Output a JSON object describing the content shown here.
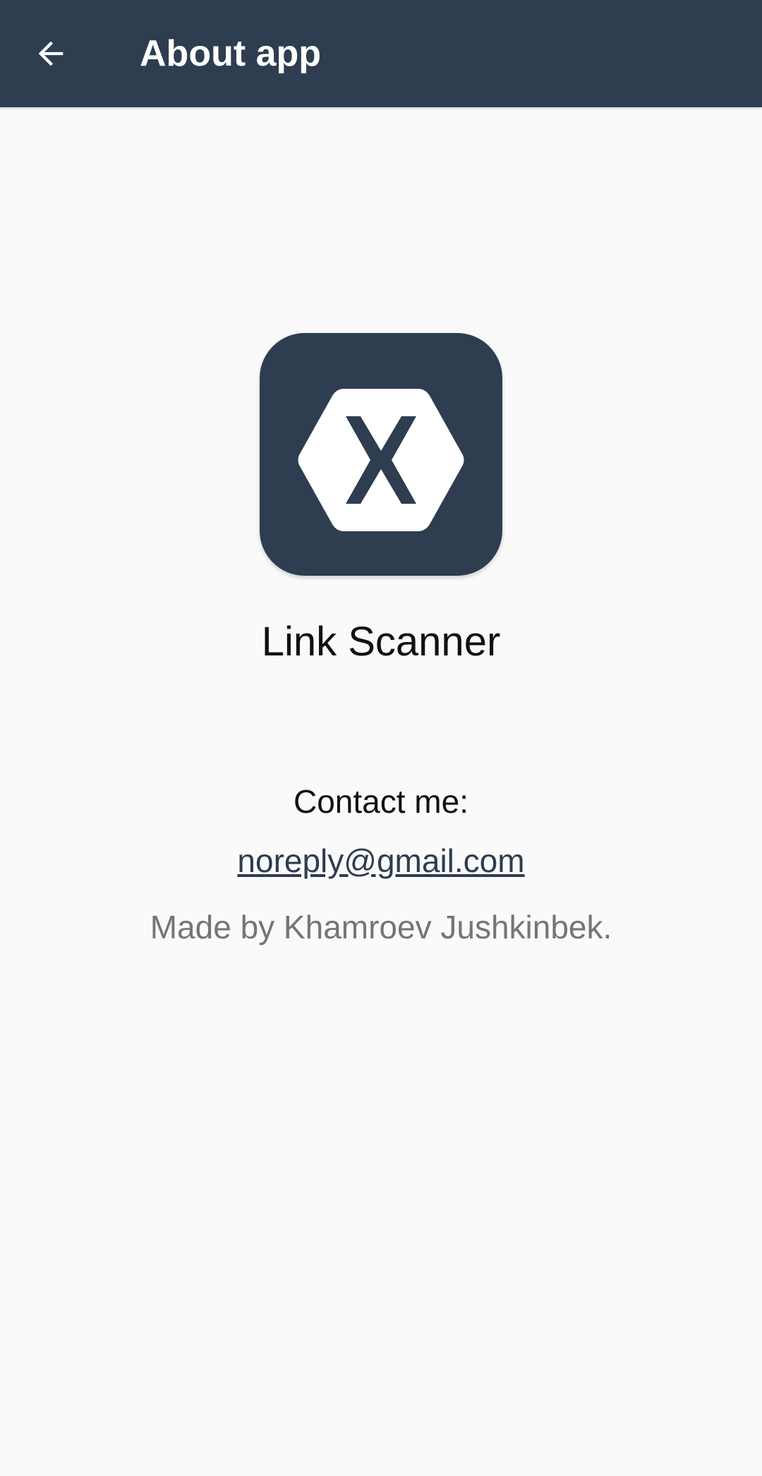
{
  "app_bar": {
    "back_icon": "arrow-left-icon",
    "title": "About app",
    "background_color": "#2e3d50"
  },
  "about": {
    "logo_icon": "xamarin-hexagon-x-icon",
    "app_name": "Link Scanner",
    "contact_label": "Contact me:",
    "contact_email": "noreply@gmail.com",
    "credits": "Made by Khamroev Jushkinbek."
  }
}
